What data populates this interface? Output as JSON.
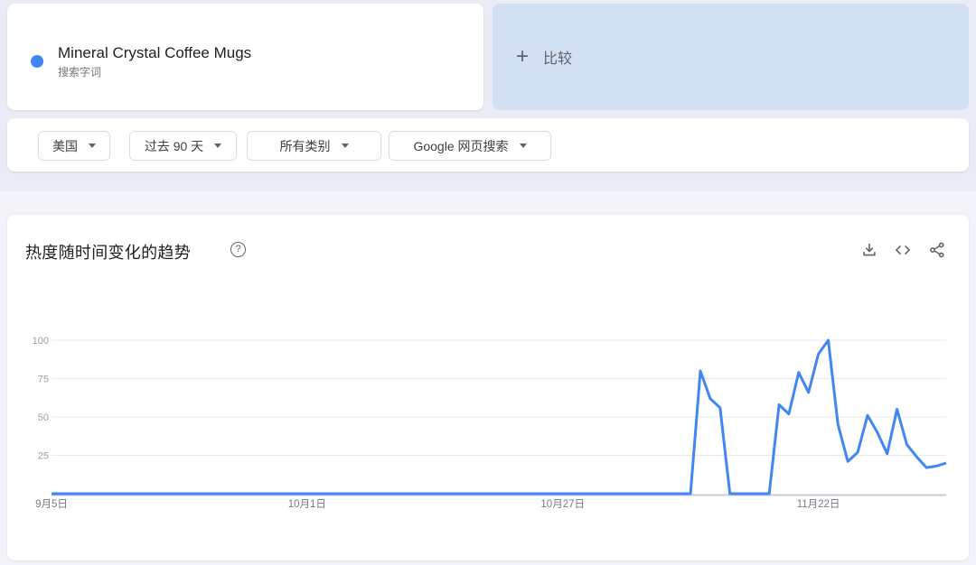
{
  "term_card": {
    "term": "Mineral Crystal Coffee Mugs",
    "type_label": "搜索字词",
    "dot_color": "#4285f4"
  },
  "compare_card": {
    "plus": "+",
    "label": "比较"
  },
  "filters": [
    {
      "label": "美国"
    },
    {
      "label": "过去 90 天"
    },
    {
      "label": "所有类别"
    },
    {
      "label": "Google 网页搜索"
    }
  ],
  "chart_card": {
    "title": "热度随时间变化的趋势",
    "help_icon": "?",
    "actions": [
      "download-icon",
      "embed-icon",
      "share-icon"
    ]
  },
  "colors": {
    "accent_blue": "#4285f4",
    "compare_bg": "#d2e0f4",
    "icon_gray": "#5f6368",
    "grid_gray": "#e7e9ee",
    "axis_gray": "#c9ccd2",
    "ytick_gray": "#9aa0a6",
    "xtick_gray": "#757b82"
  },
  "chart_data": {
    "type": "line",
    "title": "热度随时间变化的趋势",
    "series_name": "Mineral Crystal Coffee Mugs",
    "line_color": "#4285f4",
    "grid": true,
    "ylim": [
      0,
      100
    ],
    "y_ticks": [
      100,
      75,
      50,
      25
    ],
    "x_tick_labels": [
      {
        "label": "9月5日",
        "index": 0
      },
      {
        "label": "10月1日",
        "index": 26
      },
      {
        "label": "10月27日",
        "index": 52
      },
      {
        "label": "11月22日",
        "index": 78
      }
    ],
    "values": [
      0,
      0,
      0,
      0,
      0,
      0,
      0,
      0,
      0,
      0,
      0,
      0,
      0,
      0,
      0,
      0,
      0,
      0,
      0,
      0,
      0,
      0,
      0,
      0,
      0,
      0,
      0,
      0,
      0,
      0,
      0,
      0,
      0,
      0,
      0,
      0,
      0,
      0,
      0,
      0,
      0,
      0,
      0,
      0,
      0,
      0,
      0,
      0,
      0,
      0,
      0,
      0,
      0,
      0,
      0,
      0,
      0,
      0,
      0,
      0,
      0,
      0,
      0,
      0,
      0,
      0,
      80,
      62,
      56,
      0,
      0,
      0,
      0,
      0,
      58,
      52,
      79,
      66,
      91,
      100,
      45,
      21,
      27,
      51,
      40,
      26,
      55,
      32,
      24,
      17,
      18,
      20
    ]
  }
}
